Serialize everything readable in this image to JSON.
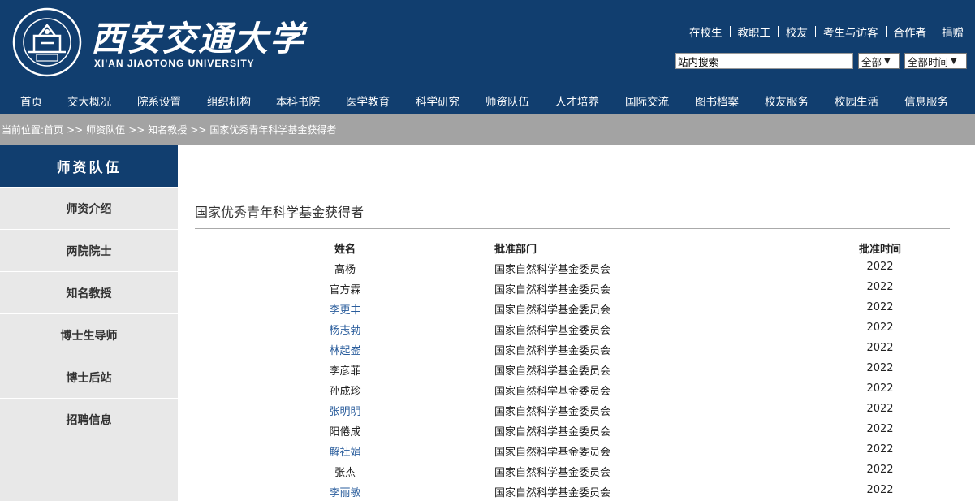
{
  "header": {
    "logo_cn": "西安交通大学",
    "logo_en": "XI'AN JIAOTONG UNIVERSITY",
    "top_links": [
      "在校生",
      "教职工",
      "校友",
      "考生与访客",
      "合作者",
      "捐赠"
    ],
    "search": {
      "value": "站内搜索",
      "scope": "全部",
      "time": "全部时间"
    },
    "nav": [
      "首页",
      "交大概况",
      "院系设置",
      "组织机构",
      "本科书院",
      "医学教育",
      "科学研究",
      "师资队伍",
      "人才培养",
      "国际交流",
      "图书档案",
      "校友服务",
      "校园生活",
      "信息服务"
    ]
  },
  "breadcrumb": {
    "prefix": "当前位置:",
    "items": [
      "首页",
      "师资队伍",
      "知名教授",
      "国家优秀青年科学基金获得者"
    ],
    "sep": ">>"
  },
  "sidebar": {
    "title": "师资队伍",
    "items": [
      "师资介绍",
      "两院院士",
      "知名教授",
      "博士生导师",
      "博士后站",
      "招聘信息"
    ]
  },
  "main": {
    "title": "国家优秀青年科学基金获得者",
    "columns": [
      "姓名",
      "批准部门",
      "批准时间"
    ],
    "rows": [
      {
        "name": "高杨",
        "dept": "国家自然科学基金委员会",
        "year": "2022",
        "link": false
      },
      {
        "name": "官方霖",
        "dept": "国家自然科学基金委员会",
        "year": "2022",
        "link": false
      },
      {
        "name": "李更丰",
        "dept": "国家自然科学基金委员会",
        "year": "2022",
        "link": true
      },
      {
        "name": "杨志勃",
        "dept": "国家自然科学基金委员会",
        "year": "2022",
        "link": true
      },
      {
        "name": "林起崟",
        "dept": "国家自然科学基金委员会",
        "year": "2022",
        "link": true
      },
      {
        "name": "李彦菲",
        "dept": "国家自然科学基金委员会",
        "year": "2022",
        "link": false
      },
      {
        "name": "孙成珍",
        "dept": "国家自然科学基金委员会",
        "year": "2022",
        "link": false
      },
      {
        "name": "张明明",
        "dept": "国家自然科学基金委员会",
        "year": "2022",
        "link": true
      },
      {
        "name": "阳倦成",
        "dept": "国家自然科学基金委员会",
        "year": "2022",
        "link": false
      },
      {
        "name": "解社娟",
        "dept": "国家自然科学基金委员会",
        "year": "2022",
        "link": true
      },
      {
        "name": "张杰",
        "dept": "国家自然科学基金委员会",
        "year": "2022",
        "link": false
      },
      {
        "name": "李丽敏",
        "dept": "国家自然科学基金委员会",
        "year": "2022",
        "link": true
      }
    ]
  },
  "colors": {
    "brand": "#113e6f",
    "breadcrumb_bg": "#a3a3a3",
    "sidebar_bg": "#e8e8e8",
    "link": "#2a5d9c"
  },
  "icons": {
    "logo": "university-emblem-icon",
    "dropdown": "chevron-down-icon"
  }
}
